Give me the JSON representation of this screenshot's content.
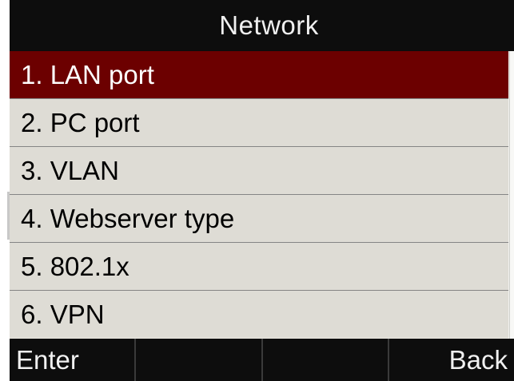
{
  "header": {
    "title": "Network"
  },
  "menu": {
    "selected_index": 0,
    "items": [
      {
        "label": "1. LAN port"
      },
      {
        "label": "2. PC port"
      },
      {
        "label": "3. VLAN"
      },
      {
        "label": "4. Webserver type"
      },
      {
        "label": "5. 802.1x"
      },
      {
        "label": "6. VPN"
      }
    ]
  },
  "softkeys": {
    "keys": [
      {
        "label": "Enter"
      },
      {
        "label": ""
      },
      {
        "label": ""
      },
      {
        "label": "Back"
      }
    ]
  },
  "colors": {
    "title_bar": "#0d0d0d",
    "selected_row": "#6c0000",
    "row_background": "#dedcd5",
    "softkey_bar": "#0d0d0d"
  }
}
